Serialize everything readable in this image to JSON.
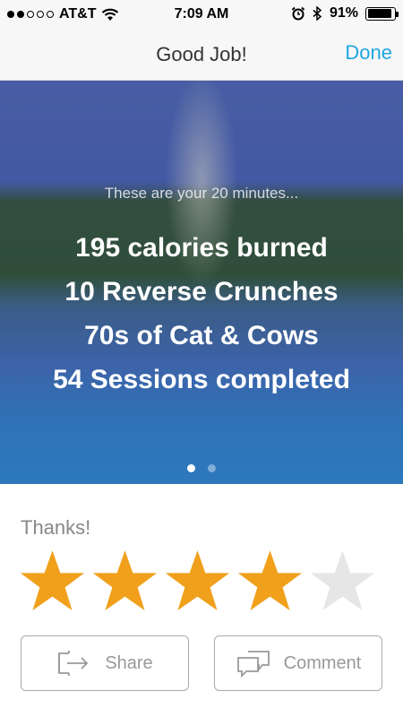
{
  "status_bar": {
    "carrier": "AT&T",
    "time": "7:09 AM",
    "battery": "91%",
    "battery_level": 0.91,
    "signal_bars": 2,
    "icons": [
      "wifi-icon",
      "alarm-icon",
      "bluetooth-icon",
      "battery-icon"
    ]
  },
  "nav": {
    "title": "Good Job!",
    "done_label": "Done",
    "accent_color": "#1fa7e0"
  },
  "hero": {
    "intro": "These are your 20 minutes...",
    "stats": [
      "195 calories burned",
      "10 Reverse Crunches",
      "70s of Cat & Cows",
      "54 Sessions completed"
    ],
    "page_count": 2,
    "active_page": 1
  },
  "rating": {
    "label": "Thanks!",
    "value": 4,
    "max": 5,
    "filled_color": "#f0a01b",
    "empty_color": "#e6e6e6"
  },
  "actions": {
    "share_label": "Share",
    "comment_label": "Comment"
  }
}
